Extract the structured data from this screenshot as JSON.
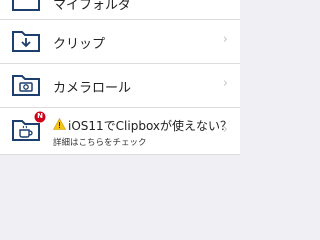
{
  "menu": {
    "items": [
      {
        "label": "マイフォルダ"
      },
      {
        "label": "クリップ"
      },
      {
        "label": "カメラロール"
      }
    ],
    "notice": {
      "title": "iOS11でClipboxが使えない？",
      "subtitle": "詳細はこちらをチェック",
      "badge": "N"
    },
    "chevron": "›"
  },
  "colors": {
    "icon": "#1c3f6e",
    "badge": "#d0021b",
    "warning": "#f5c518"
  }
}
